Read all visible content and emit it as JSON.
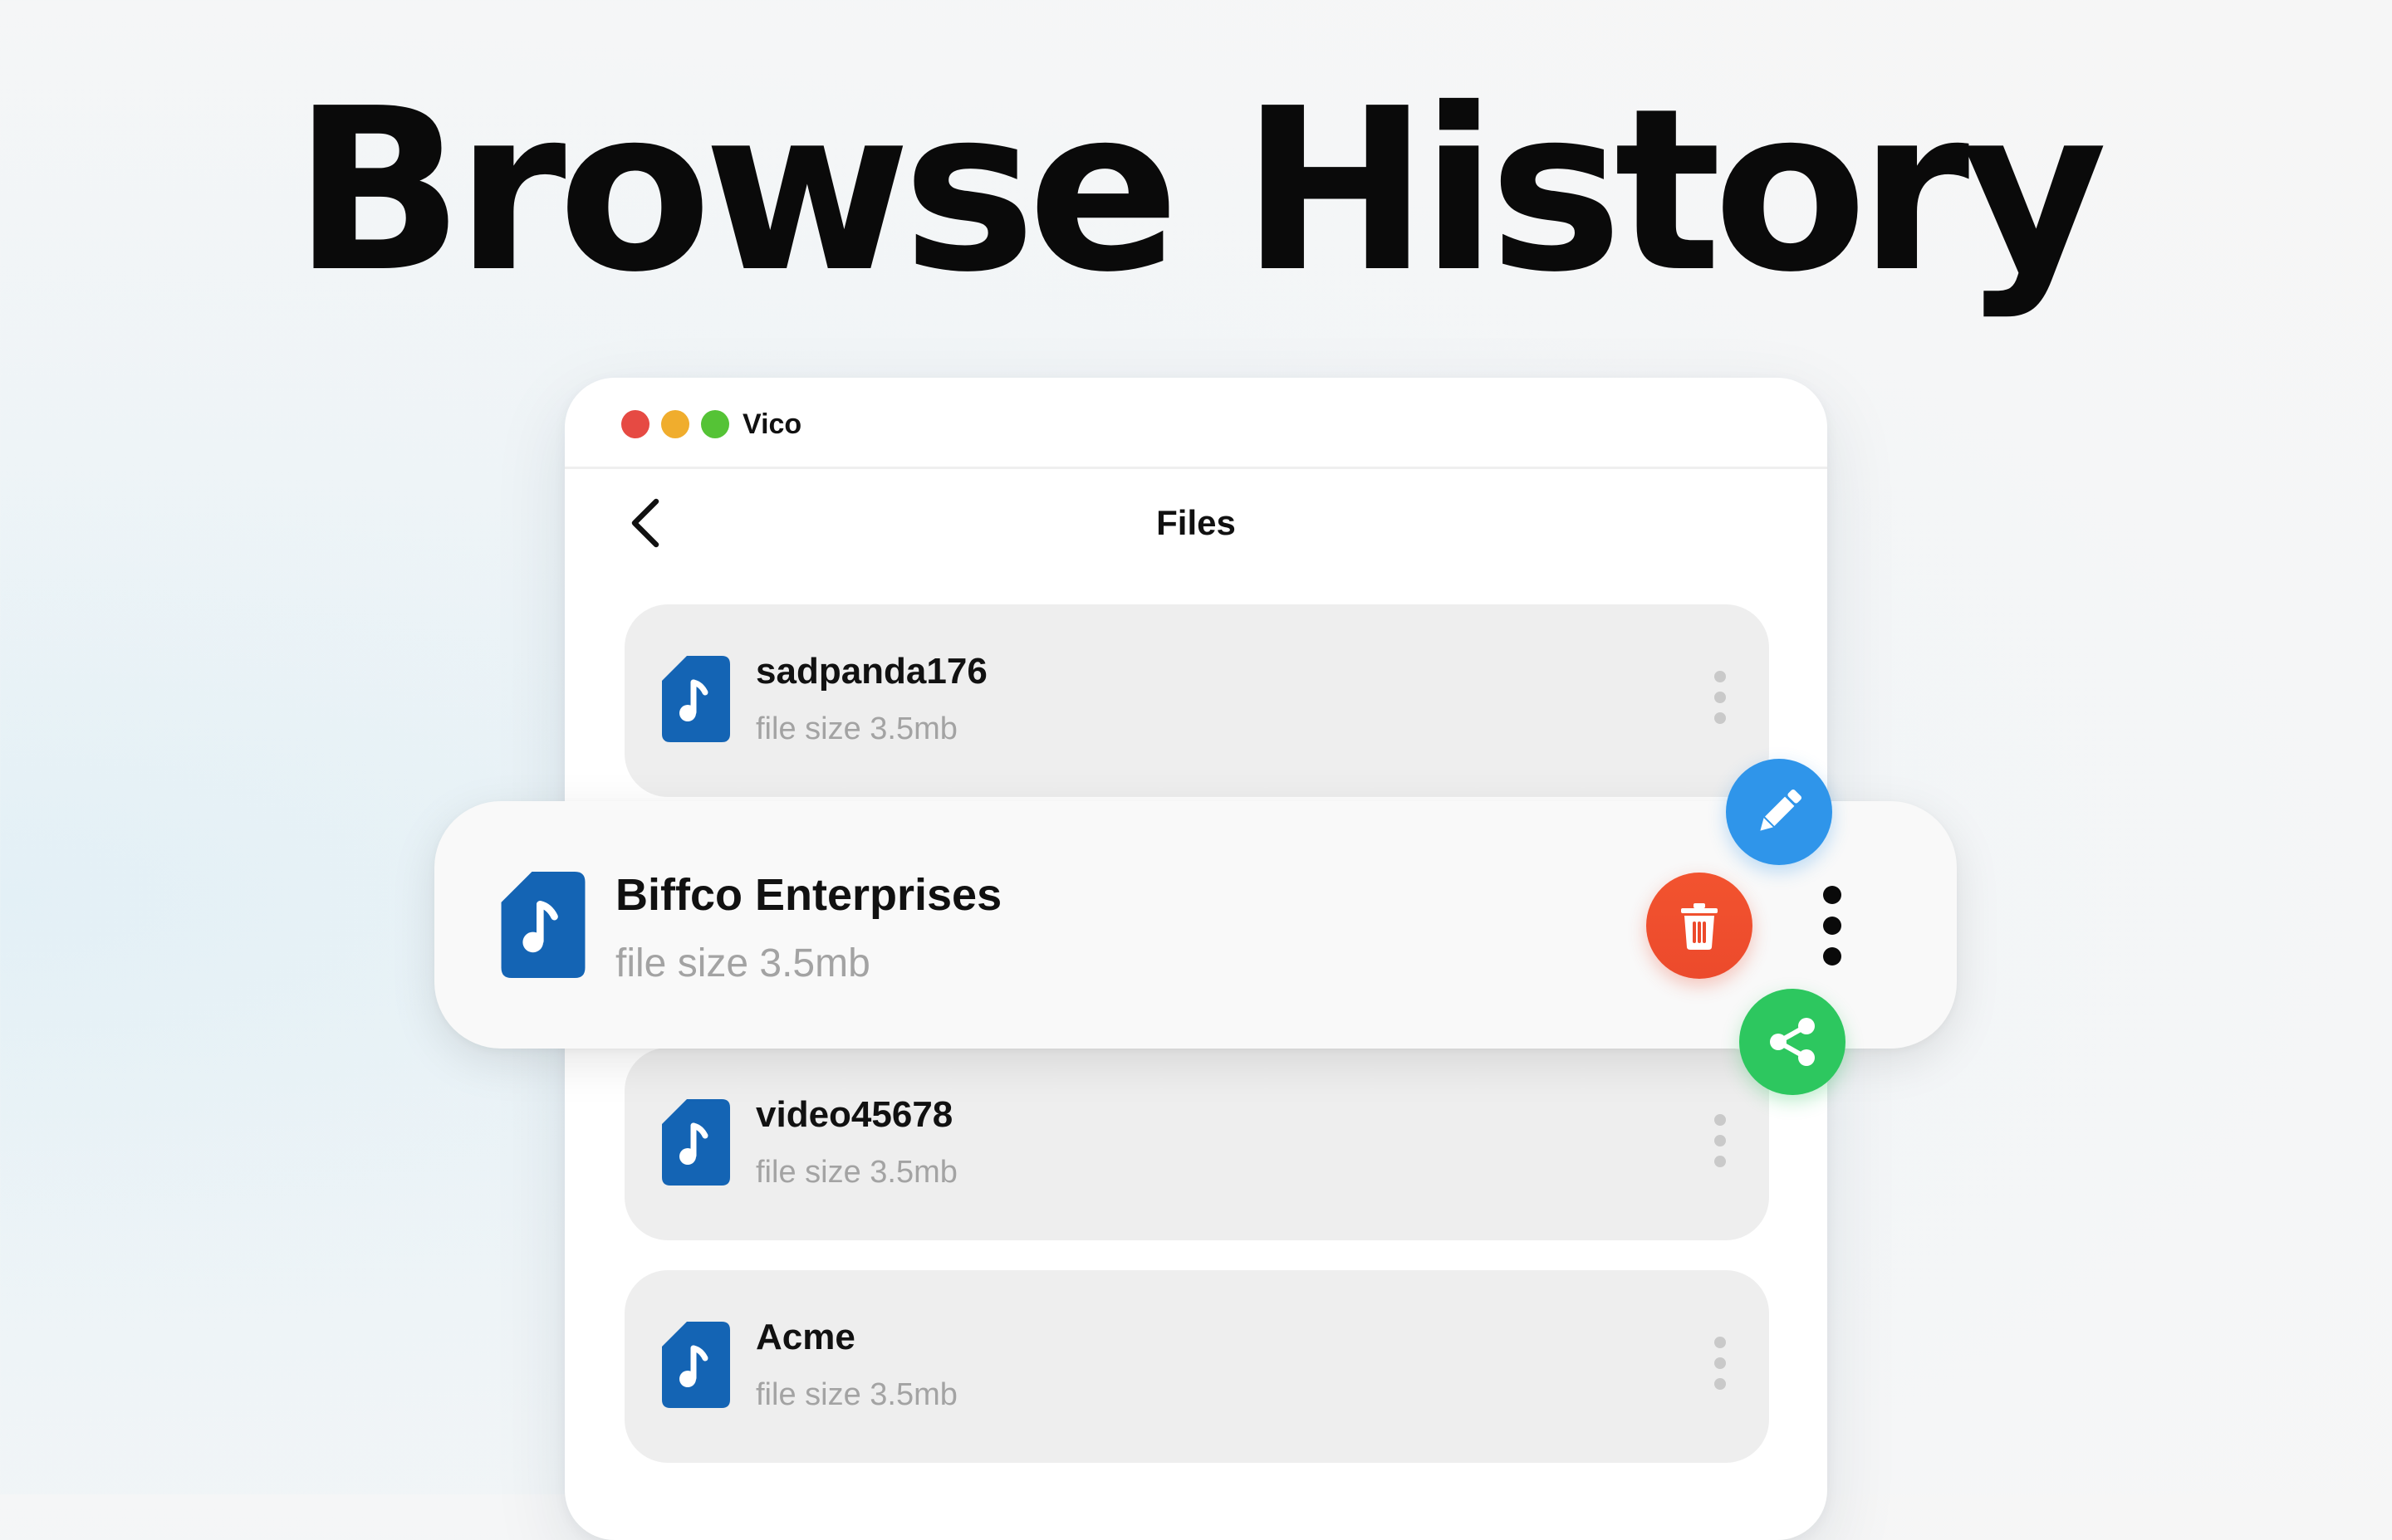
{
  "headline": "Browse History",
  "window": {
    "app_name": "Vico",
    "page_title": "Files"
  },
  "files": [
    {
      "name": "sadpanda176",
      "size": "file size 3.5mb"
    },
    {
      "name": "Biffco Enterprises",
      "size": "file size 3.5mb"
    },
    {
      "name": "video45678",
      "size": "file size 3.5mb"
    },
    {
      "name": "Acme",
      "size": "file size 3.5mb"
    }
  ],
  "icons": {
    "back": "chevron-left-icon",
    "file": "music-file-icon",
    "more": "more-vertical-icon",
    "edit": "pencil-icon",
    "delete": "trash-icon",
    "share": "share-icon"
  },
  "colors": {
    "file_icon": "#1464b4",
    "edit": "#2f95ea",
    "delete": "#ec4a2c",
    "share": "#2dc75f",
    "traffic_red": "#e64a43",
    "traffic_yellow": "#f0ad2d",
    "traffic_green": "#55c336"
  }
}
